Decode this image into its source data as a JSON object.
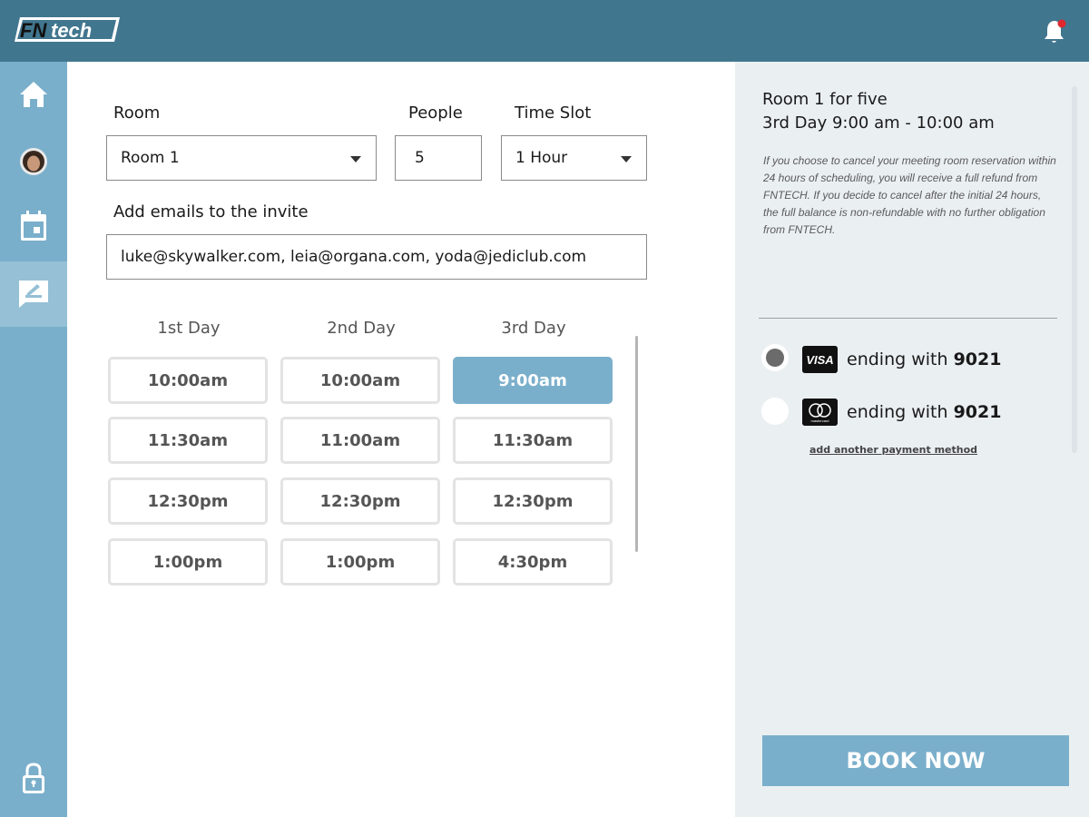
{
  "header": {
    "logo_text": "FNtech",
    "colors": {
      "bar": "#41768f",
      "sidebar": "#7aafcb",
      "accent": "#7aafcb",
      "notification_dot": "#e0282e"
    }
  },
  "sidebar": {
    "items": [
      {
        "icon": "home-icon"
      },
      {
        "icon": "avatar"
      },
      {
        "icon": "calendar-icon"
      },
      {
        "icon": "sign-icon",
        "active": true
      },
      {
        "icon": "lock-icon"
      }
    ]
  },
  "form": {
    "room_label": "Room",
    "room_value": "Room 1",
    "people_label": "People",
    "people_value": "5",
    "timeslot_label": "Time Slot",
    "timeslot_value": "1 Hour",
    "emails_label": "Add emails to the invite",
    "emails_value": "luke@skywalker.com, leia@organa.com, yoda@jediclub.com"
  },
  "schedule": {
    "days": [
      {
        "label": "1st Day",
        "slots": [
          "10:00am",
          "11:30am",
          "12:30pm",
          "1:00pm"
        ]
      },
      {
        "label": "2nd Day",
        "slots": [
          "10:00am",
          "11:00am",
          "12:30pm",
          "1:00pm"
        ]
      },
      {
        "label": "3rd Day",
        "slots": [
          "9:00am",
          "11:30am",
          "12:30pm",
          "4:30pm"
        ]
      }
    ],
    "selected": {
      "day": 2,
      "slot": 0
    }
  },
  "summary": {
    "line1": "Room 1 for five",
    "line2": "3rd Day  9:00 am - 10:00 am",
    "policy": "If you choose to cancel your meeting room reservation within 24 hours of scheduling, you will receive a full refund from FNTECH. If you decide to cancel after the initial 24 hours, the full balance is non-refundable with no further obligation from FNTECH."
  },
  "payment": {
    "methods": [
      {
        "brand": "VISA",
        "prefix": "ending with ",
        "last4": "9021",
        "selected": true
      },
      {
        "brand": "mastercard",
        "prefix": "ending with ",
        "last4": "9021",
        "selected": false
      }
    ],
    "add_link": "add another payment method"
  },
  "book_button": "BOOK NOW"
}
